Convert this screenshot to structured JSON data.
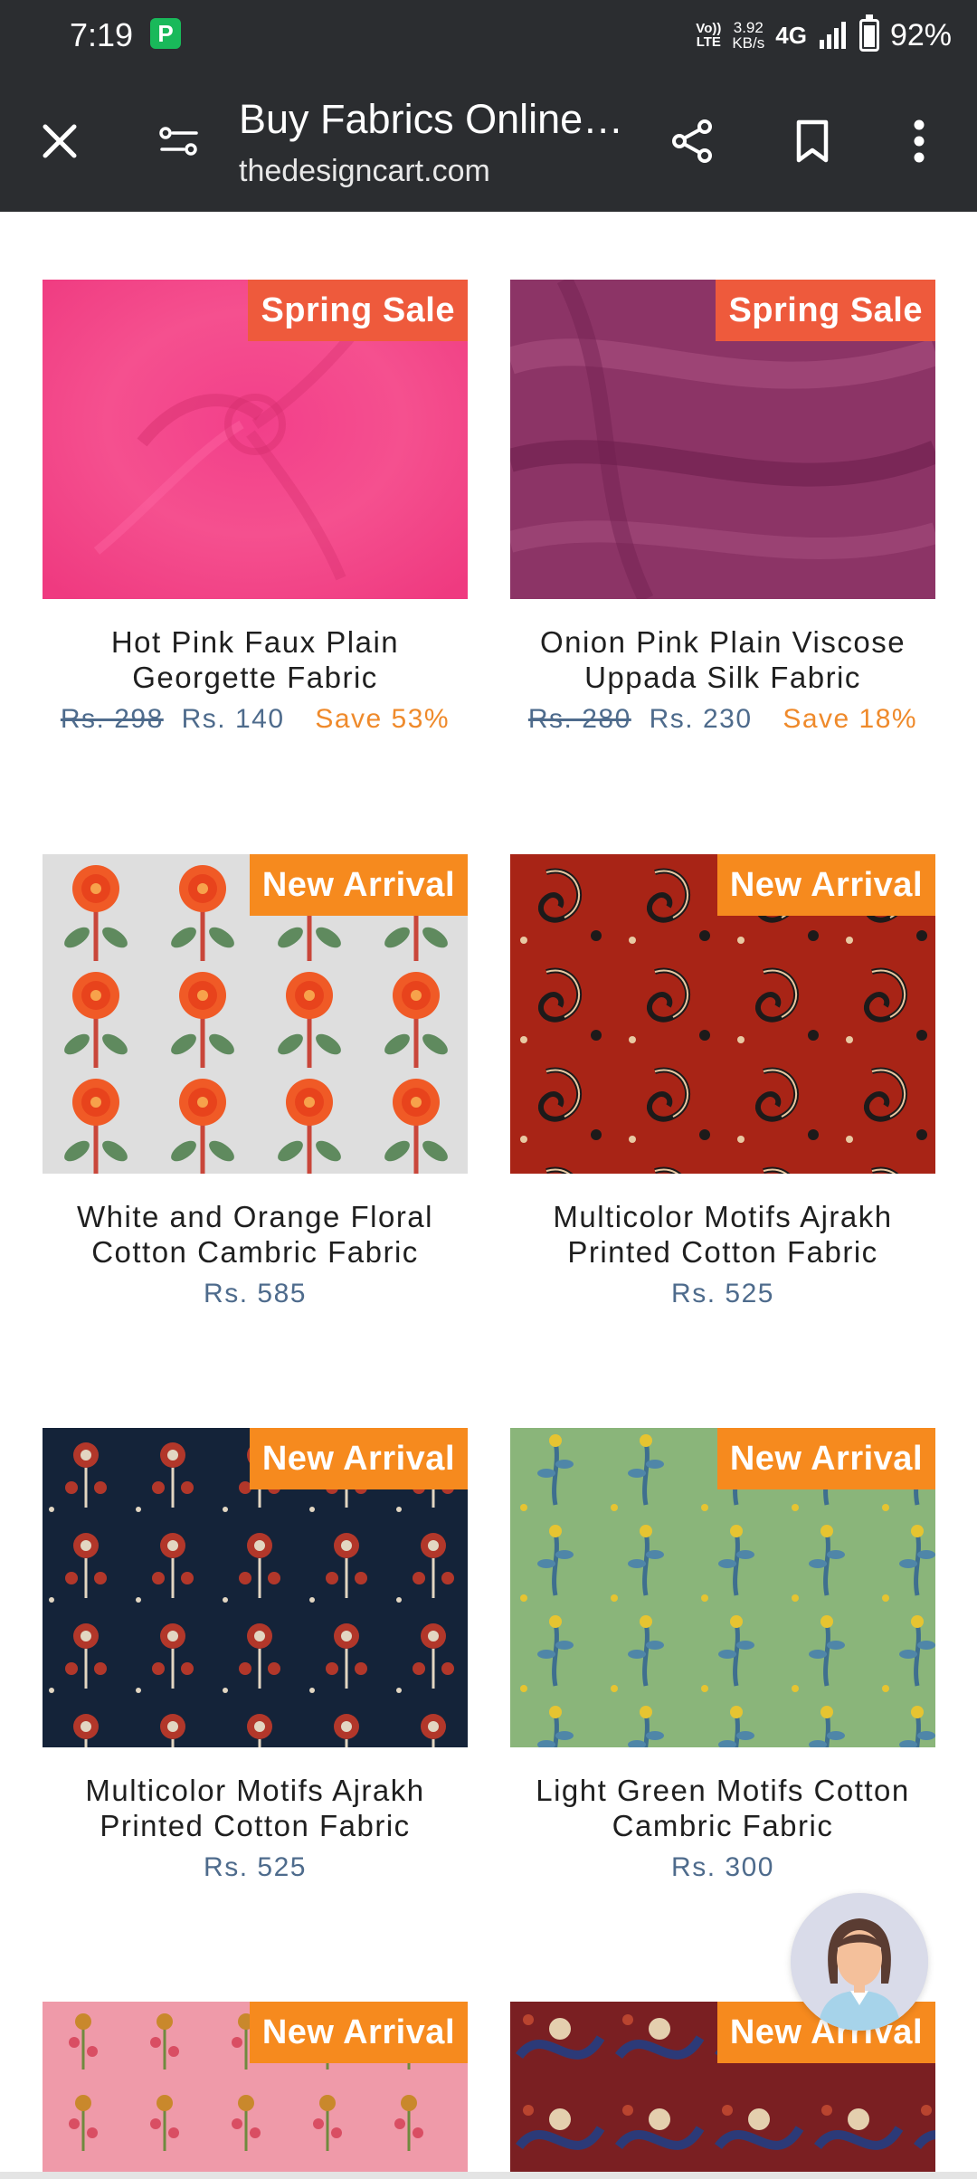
{
  "status_bar": {
    "time": "7:19",
    "volte_top": "Vo))",
    "volte_bottom": "LTE",
    "net_speed_value": "3.92",
    "net_speed_unit": "KB/s",
    "network": "4G",
    "battery": "92%",
    "battery_level": 0.92
  },
  "toolbar": {
    "title": "Buy Fabrics Online…",
    "url": "thedesigncart.com"
  },
  "products": [
    {
      "badge": "Spring Sale",
      "badge_type": "sale",
      "title": "Hot Pink Faux Plain Georgette Fabric",
      "old_price": "Rs. 298",
      "price": "Rs. 140",
      "save": "Save 53%"
    },
    {
      "badge": "Spring Sale",
      "badge_type": "sale",
      "title": "Onion Pink Plain Viscose Uppada Silk Fabric",
      "old_price": "Rs. 280",
      "price": "Rs. 230",
      "save": "Save 18%"
    },
    {
      "badge": "New Arrival",
      "badge_type": "new",
      "title": "White and Orange Floral Cotton Cambric Fabric",
      "old_price": "",
      "price": "Rs. 585",
      "save": ""
    },
    {
      "badge": "New Arrival",
      "badge_type": "new",
      "title": "Multicolor Motifs Ajrakh Printed Cotton Fabric",
      "old_price": "",
      "price": "Rs. 525",
      "save": ""
    },
    {
      "badge": "New Arrival",
      "badge_type": "new",
      "title": "Multicolor Motifs Ajrakh Printed Cotton Fabric",
      "old_price": "",
      "price": "Rs. 525",
      "save": ""
    },
    {
      "badge": "New Arrival",
      "badge_type": "new",
      "title": "Light Green Motifs Cotton Cambric Fabric",
      "old_price": "",
      "price": "Rs. 300",
      "save": ""
    },
    {
      "badge": "New Arrival",
      "badge_type": "new",
      "title": "",
      "old_price": "",
      "price": "",
      "save": ""
    },
    {
      "badge": "New Arrival",
      "badge_type": "new",
      "title": "",
      "old_price": "",
      "price": "",
      "save": ""
    }
  ],
  "colors": {
    "toolbar_bg": "#2b2d30",
    "sale_badge": "#ee5a3c",
    "new_badge": "#f68a1e",
    "price": "#4e6b8c",
    "save": "#ef8a2b"
  },
  "icons": [
    "close-icon",
    "site-settings-icon",
    "share-icon",
    "bookmark-icon",
    "more-vert-icon",
    "chat-avatar-icon"
  ]
}
